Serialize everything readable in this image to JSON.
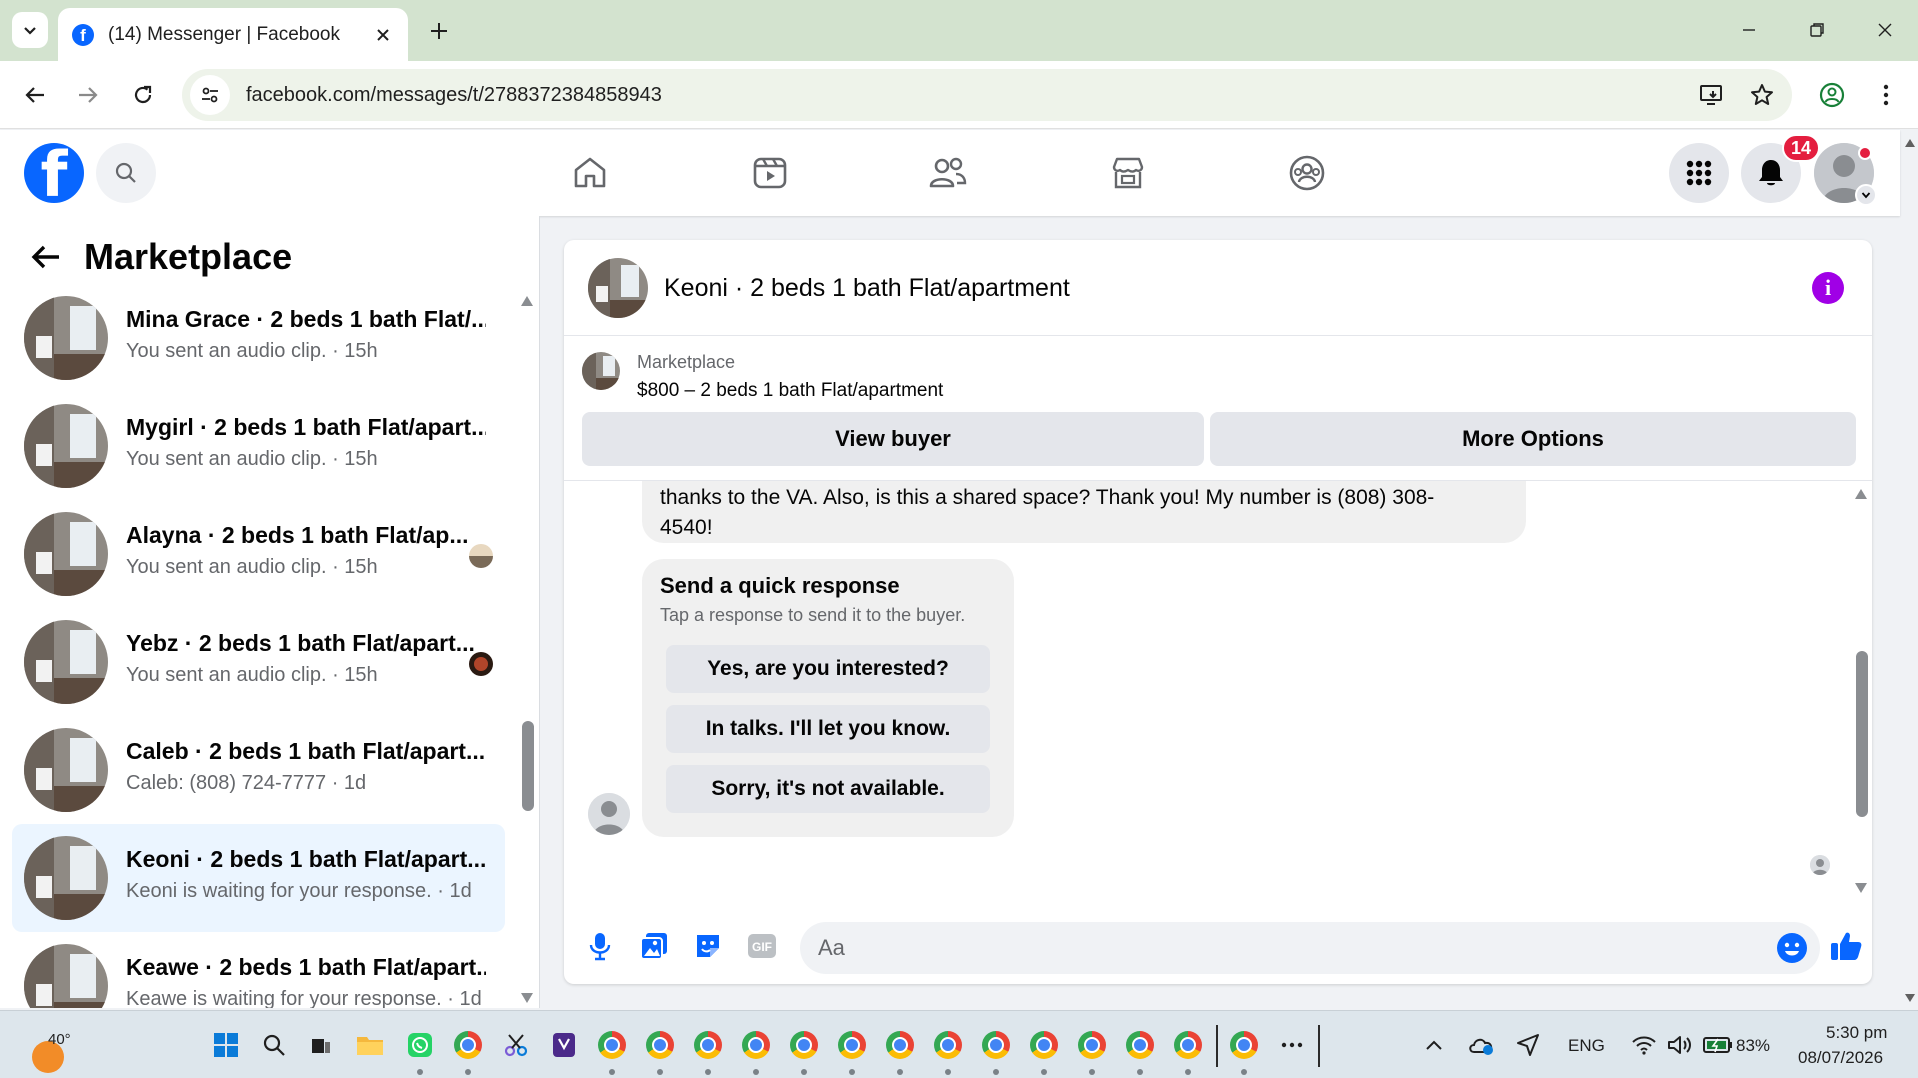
{
  "browser": {
    "tab_title": "(14) Messenger | Facebook",
    "url": "facebook.com/messages/t/2788372384858943"
  },
  "fb_header": {
    "notifications_count": "14",
    "colors": {
      "brand": "#0866ff",
      "badge": "#e41e3f"
    }
  },
  "left_panel": {
    "title": "Marketplace",
    "conversations": [
      {
        "name": "Mina Grace · 2 beds 1 bath Flat/...",
        "subtitle": "You sent an audio clip. · 15h"
      },
      {
        "name": "Mygirl · 2 beds 1 bath Flat/apart...",
        "subtitle": "You sent an audio clip. · 15h"
      },
      {
        "name": "Alayna · 2 beds 1 bath Flat/ap...",
        "subtitle": "You sent an audio clip. · 15h"
      },
      {
        "name": "Yebz · 2 beds 1 bath Flat/apart...",
        "subtitle": "You sent an audio clip. · 15h"
      },
      {
        "name": "Caleb · 2 beds 1 bath Flat/apart...",
        "subtitle": "Caleb: (808) 724-7777 · 1d"
      },
      {
        "name": "Keoni · 2 beds 1 bath Flat/apart...",
        "subtitle": "Keoni is waiting for your response. · 1d"
      },
      {
        "name": "Keawe · 2 beds 1 bath Flat/apart...",
        "subtitle": "Keawe is waiting for your response. · 1d"
      }
    ]
  },
  "chat": {
    "title": "Keoni · 2 beds 1 bath Flat/apartment",
    "marketplace_label": "Marketplace",
    "listing": "$800 – 2 beds 1 bath Flat/apartment",
    "view_buyer": "View buyer",
    "more_options": "More Options",
    "message_line1": "thanks to the VA. Also, is this a shared space? Thank you! My number is (808) 308-",
    "message_line2": "4540!",
    "quick_response": {
      "title": "Send a quick response",
      "subtitle": "Tap a response to send it to the buyer.",
      "options": [
        "Yes, are you interested?",
        "In talks. I'll let you know.",
        "Sorry, it's not available."
      ]
    },
    "composer_placeholder": "Aa"
  },
  "taskbar": {
    "temperature": "40°",
    "language": "ENG",
    "battery": "83%",
    "time": "5:30 pm",
    "date": "08/07/2026"
  }
}
